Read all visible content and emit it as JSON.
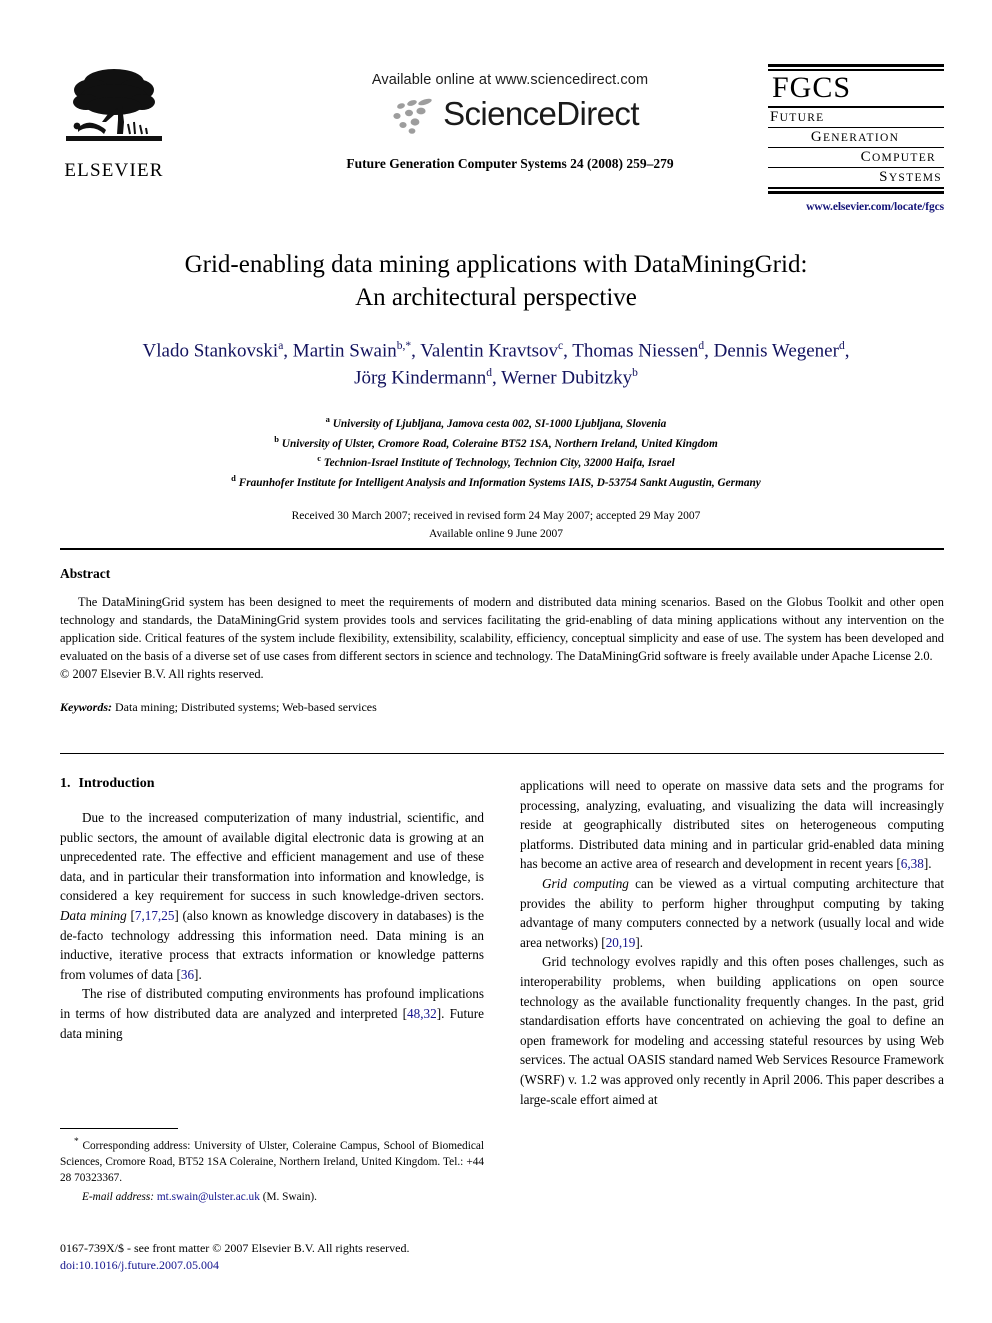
{
  "header": {
    "publisher_name": "ELSEVIER",
    "publisher_logo_icon": "elsevier-tree-icon",
    "available_online": "Available online at www.sciencedirect.com",
    "sciencedirect_wordmark": "ScienceDirect",
    "sciencedirect_logo_icon": "sciencedirect-dots-icon",
    "journal_citation": "Future Generation Computer Systems 24 (2008) 259–279",
    "fgcs": {
      "acronym": "FGCS",
      "line1_cap": "F",
      "line1_rest": "UTURE",
      "line2_cap": "G",
      "line2_rest": "ENERATION",
      "line3_cap": "C",
      "line3_rest": "OMPUTER",
      "line4_cap": "S",
      "line4_rest": "YSTEMS",
      "url": "www.elsevier.com/locate/fgcs"
    }
  },
  "title": {
    "line1": "Grid-enabling data mining applications with DataMiningGrid:",
    "line2": "An architectural perspective"
  },
  "authors": {
    "line1": "Vlado Stankovski<sup>a</sup>, Martin Swain<sup>b,*</sup>, Valentin Kravtsov<sup>c</sup>, Thomas Niessen<sup>d</sup>, Dennis Wegener<sup>d</sup>,",
    "line2": "Jörg Kindermann<sup>d</sup>, Werner Dubitzky<sup>b</sup>",
    "color": "#13135e"
  },
  "affiliations": [
    "<sup>a</sup> University of Ljubljana, Jamova cesta 002, SI-1000 Ljubljana, Slovenia",
    "<sup>b</sup> University of Ulster, Cromore Road, Coleraine BT52 1SA, Northern Ireland, United Kingdom",
    "<sup>c</sup> Technion-Israel Institute of Technology, Technion City, 32000 Haifa, Israel",
    "<sup>d</sup> Fraunhofer Institute for Intelligent Analysis and Information Systems IAIS, D-53754 Sankt Augustin, Germany"
  ],
  "dates": {
    "received": "Received 30 March 2007; received in revised form 24 May 2007; accepted 29 May 2007",
    "available_online": "Available online 9 June 2007"
  },
  "abstract": {
    "heading": "Abstract",
    "text": "The DataMiningGrid system has been designed to meet the requirements of modern and distributed data mining scenarios. Based on the Globus Toolkit and other open technology and standards, the DataMiningGrid system provides tools and services facilitating the grid-enabling of data mining applications without any intervention on the application side. Critical features of the system include flexibility, extensibility, scalability, efficiency, conceptual simplicity and ease of use. The system has been developed and evaluated on the basis of a diverse set of use cases from different sectors in science and technology. The DataMiningGrid software is freely available under Apache License 2.0.",
    "copyright": "© 2007 Elsevier B.V. All rights reserved.",
    "keywords_label": "Keywords:",
    "keywords_value": "Data mining; Distributed systems; Web-based services"
  },
  "section": {
    "number": "1.",
    "heading": "Introduction"
  },
  "body": {
    "left": [
      "Due to the increased computerization of many industrial, scientific, and public sectors, the amount of available digital electronic data is growing at an unprecedented rate. The effective and efficient management and use of these data, and in particular their transformation into information and knowledge, is considered a key requirement for success in such knowledge-driven sectors. <i class=\"it\">Data mining</i> [<span class=\"ref\">7,17,25</span>] (also known as knowledge discovery in databases) is the de-facto technology addressing this information need. Data mining is an inductive, iterative process that extracts information or knowledge patterns from volumes of data [<span class=\"ref\">36</span>].",
      "The rise of distributed computing environments has profound implications in terms of how distributed data are analyzed and interpreted [<span class=\"ref\">48,32</span>]. Future data mining"
    ],
    "right": [
      "applications will need to operate on massive data sets and the programs for processing, analyzing, evaluating, and visualizing the data will increasingly reside at geographically distributed sites on heterogeneous computing platforms. Distributed data mining and in particular grid-enabled data mining has become an active area of research and development in recent years [<span class=\"ref\">6,38</span>].",
      "<i class=\"it\">Grid computing</i> can be viewed as a virtual computing architecture that provides the ability to perform higher throughput computing by taking advantage of many computers connected by a network (usually local and wide area networks) [<span class=\"ref\">20,19</span>].",
      "Grid technology evolves rapidly and this often poses challenges, such as interoperability problems, when building applications on open source technology as the available functionality frequently changes. In the past, grid standardisation efforts have concentrated on achieving the goal to define an open framework for modeling and accessing stateful resources by using Web services. The actual OASIS standard named Web Services Resource Framework (WSRF) v. 1.2 was approved only recently in April 2006. This paper describes a large-scale effort aimed at"
    ]
  },
  "footnotes": {
    "corresponding": "<sup>*</sup> Corresponding address: University of Ulster, Coleraine Campus, School of Biomedical Sciences, Cromore Road, BT52 1SA Coleraine, Northern Ireland, United Kingdom. Tel.: +44 28 70323367.",
    "email_label": "E-mail address:",
    "email_value": "mt.swain@ulster.ac.uk",
    "email_suffix": "(M. Swain)."
  },
  "imprint": {
    "line1": "0167-739X/$ - see front matter © 2007 Elsevier B.V. All rights reserved.",
    "doi": "doi:10.1016/j.future.2007.05.004"
  }
}
